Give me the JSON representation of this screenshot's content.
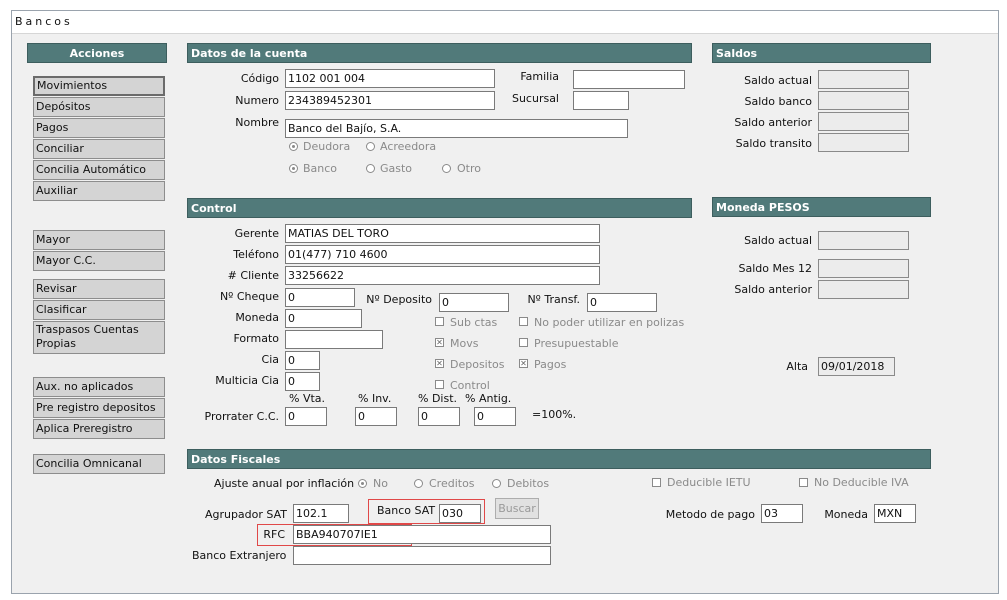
{
  "window": {
    "title": "Bancos"
  },
  "actions": {
    "header": "Acciones",
    "group1": [
      "Movimientos",
      "Depósitos",
      "Pagos",
      "Conciliar",
      "Concilia Automático",
      "Auxiliar"
    ],
    "group2": [
      "Mayor",
      "Mayor C.C."
    ],
    "group3": [
      "Revisar",
      "Clasificar",
      "Traspasos  Cuentas Propias"
    ],
    "group4": [
      "Aux. no aplicados",
      "Pre registro depositos",
      "Aplica Preregistro"
    ],
    "group5": [
      "Concilia Omnicanal"
    ]
  },
  "account": {
    "header": "Datos de la cuenta",
    "codigo_label": "Código",
    "codigo": "1102 001 004",
    "numero_label": "Numero",
    "numero": "234389452301",
    "nombre_label": "Nombre",
    "nombre": "Banco del Bajío, S.A.",
    "familia_label": "Familia",
    "familia": "",
    "sucursal_label": "Sucursal",
    "sucursal": "",
    "deudora": "Deudora",
    "acreedora": "Acreedora",
    "banco": "Banco",
    "gasto": "Gasto",
    "otro": "Otro"
  },
  "saldos": {
    "header": "Saldos",
    "actual": "Saldo actual",
    "banco": "Saldo banco",
    "anterior": "Saldo anterior",
    "transito": "Saldo transito"
  },
  "control": {
    "header": "Control",
    "gerente_label": "Gerente",
    "gerente": "MATIAS DEL TORO",
    "telefono_label": "Teléfono",
    "telefono": "01(477) 710 4600",
    "cliente_label": "# Cliente",
    "cliente": "33256622",
    "cheque_label": "Nº Cheque",
    "cheque": "0",
    "deposito_label": "Nº Deposito",
    "deposito": "0",
    "transf_label": "Nº Transf.",
    "transf": "0",
    "moneda_label": "Moneda",
    "moneda": "0",
    "formato_label": "Formato",
    "formato": "",
    "cia_label": "Cia",
    "cia": "0",
    "multicia_label": "Multicia Cia",
    "multicia": "0",
    "prorrater_label": "Prorrater C.C.",
    "vta_label": "% Vta.",
    "vta": "0",
    "inv_label": "% Inv.",
    "inv": "0",
    "dist_label": "% Dist.",
    "dist": "0",
    "antig_label": "% Antig.",
    "antig": "0",
    "eq100": "=100%.",
    "sub_ctas": "Sub ctas",
    "movs": "Movs",
    "depositos": "Depositos",
    "control": "Control",
    "no_poder": "No poder utilizar en polizas",
    "presupuestable": "Presupuestable",
    "pagos": "Pagos"
  },
  "moneda": {
    "header": "Moneda PESOS",
    "saldo_actual": "Saldo actual",
    "saldo_mes": "Saldo Mes 12",
    "saldo_anterior": "Saldo anterior",
    "alta_label": "Alta",
    "alta": "09/01/2018"
  },
  "fiscal": {
    "header": "Datos Fiscales",
    "ajuste_label": "Ajuste anual por inflación",
    "no": "No",
    "creditos": "Creditos",
    "debitos": "Debitos",
    "ietu": "Deducible IETU",
    "no_iva": "No Deducible IVA",
    "agrupador_label": "Agrupador SAT",
    "agrupador": "102.1",
    "banco_sat_label": "Banco SAT",
    "banco_sat": "030",
    "buscar": "Buscar",
    "metodo_label": "Metodo de pago",
    "metodo": "03",
    "moneda_label": "Moneda",
    "moneda": "MXN",
    "rfc_label": "RFC",
    "rfc": "BBA940707IE1",
    "extranjero_label": "Banco Extranjero",
    "extranjero": ""
  },
  "colors": {
    "header_bg": "#517a7a",
    "highlight": "#e04848"
  }
}
